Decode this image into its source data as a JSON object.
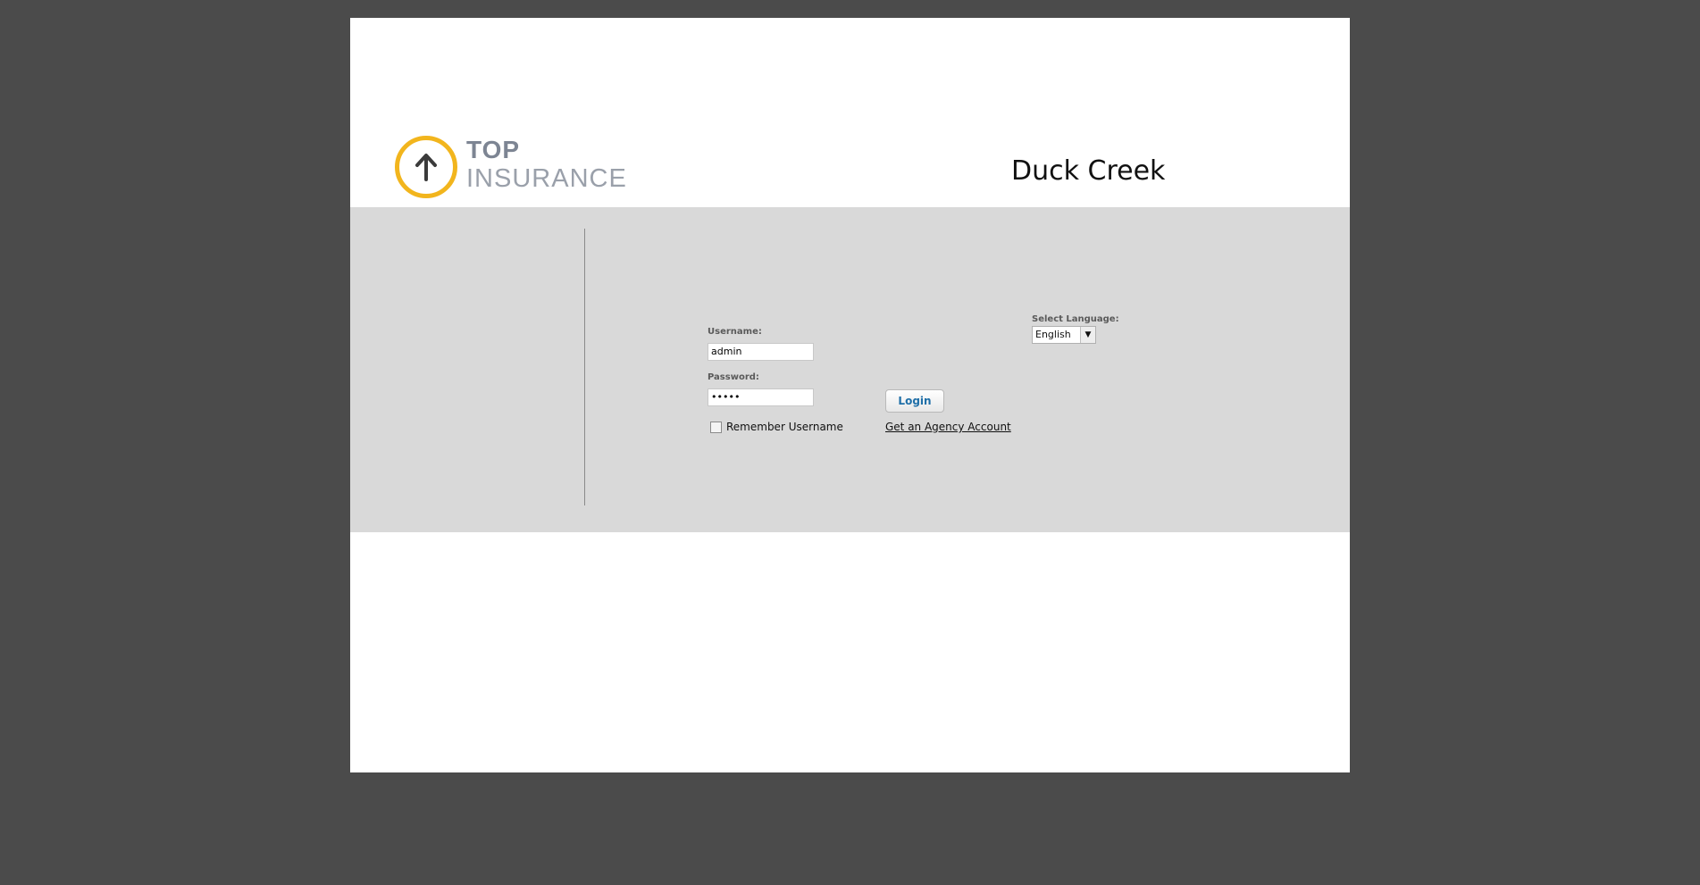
{
  "brand": {
    "logo_top": "TOP",
    "logo_bottom": "INSURANCE",
    "logo_icon": "up-arrow-circle-icon",
    "accent_color": "#f2b51d",
    "app_title": "Duck Creek"
  },
  "login": {
    "username_label": "Username:",
    "username_value": "admin",
    "password_label": "Password:",
    "password_value": "•••••",
    "remember_label": "Remember Username",
    "remember_checked": false,
    "login_button": "Login",
    "agency_link": "Get an Agency Account"
  },
  "language": {
    "label": "Select Language:",
    "selected": "English"
  }
}
